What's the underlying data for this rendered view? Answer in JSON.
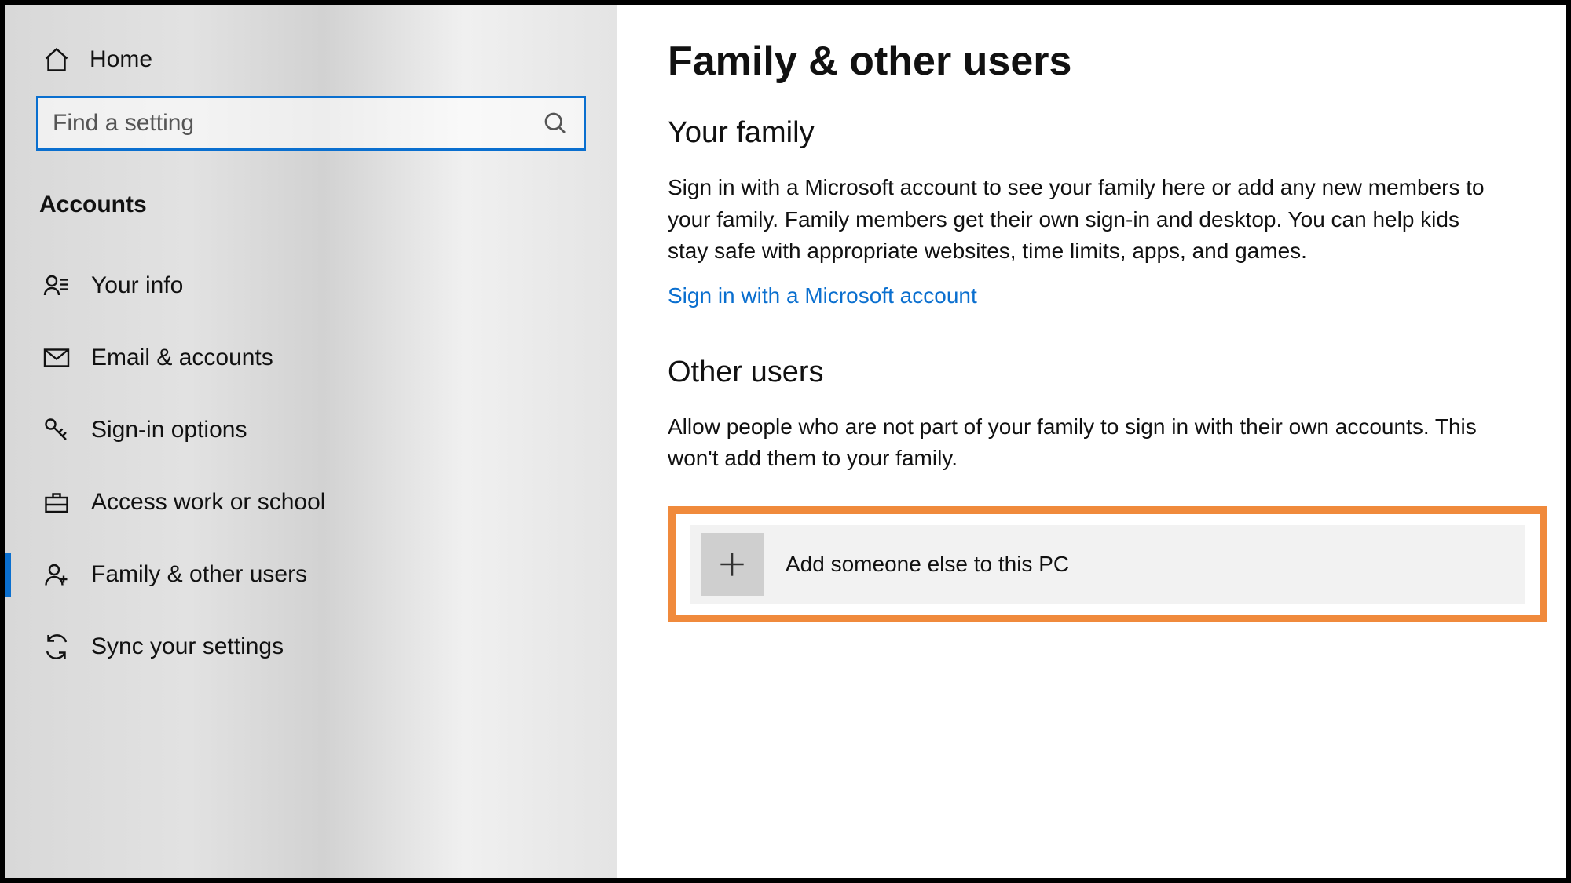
{
  "sidebar": {
    "home_label": "Home",
    "search_placeholder": "Find a setting",
    "section_title": "Accounts",
    "items": [
      {
        "label": "Your info",
        "icon": "user-info-icon",
        "active": false
      },
      {
        "label": "Email & accounts",
        "icon": "email-icon",
        "active": false
      },
      {
        "label": "Sign-in options",
        "icon": "key-icon",
        "active": false
      },
      {
        "label": "Access work or school",
        "icon": "briefcase-icon",
        "active": false
      },
      {
        "label": "Family & other users",
        "icon": "user-plus-icon",
        "active": true
      },
      {
        "label": "Sync your settings",
        "icon": "sync-icon",
        "active": false
      }
    ]
  },
  "main": {
    "page_title": "Family & other users",
    "family": {
      "heading": "Your family",
      "description": "Sign in with a Microsoft account to see your family here or add any new members to your family. Family members get their own sign-in and desktop. You can help kids stay safe with appropriate websites, time limits, apps, and games.",
      "link_label": "Sign in with a Microsoft account"
    },
    "other": {
      "heading": "Other users",
      "description": "Allow people who are not part of your family to sign in with their own accounts. This won't add them to your family.",
      "add_label": "Add someone else to this PC"
    }
  },
  "colors": {
    "accent": "#0a6fcf",
    "highlight_border": "#f08a3c"
  }
}
